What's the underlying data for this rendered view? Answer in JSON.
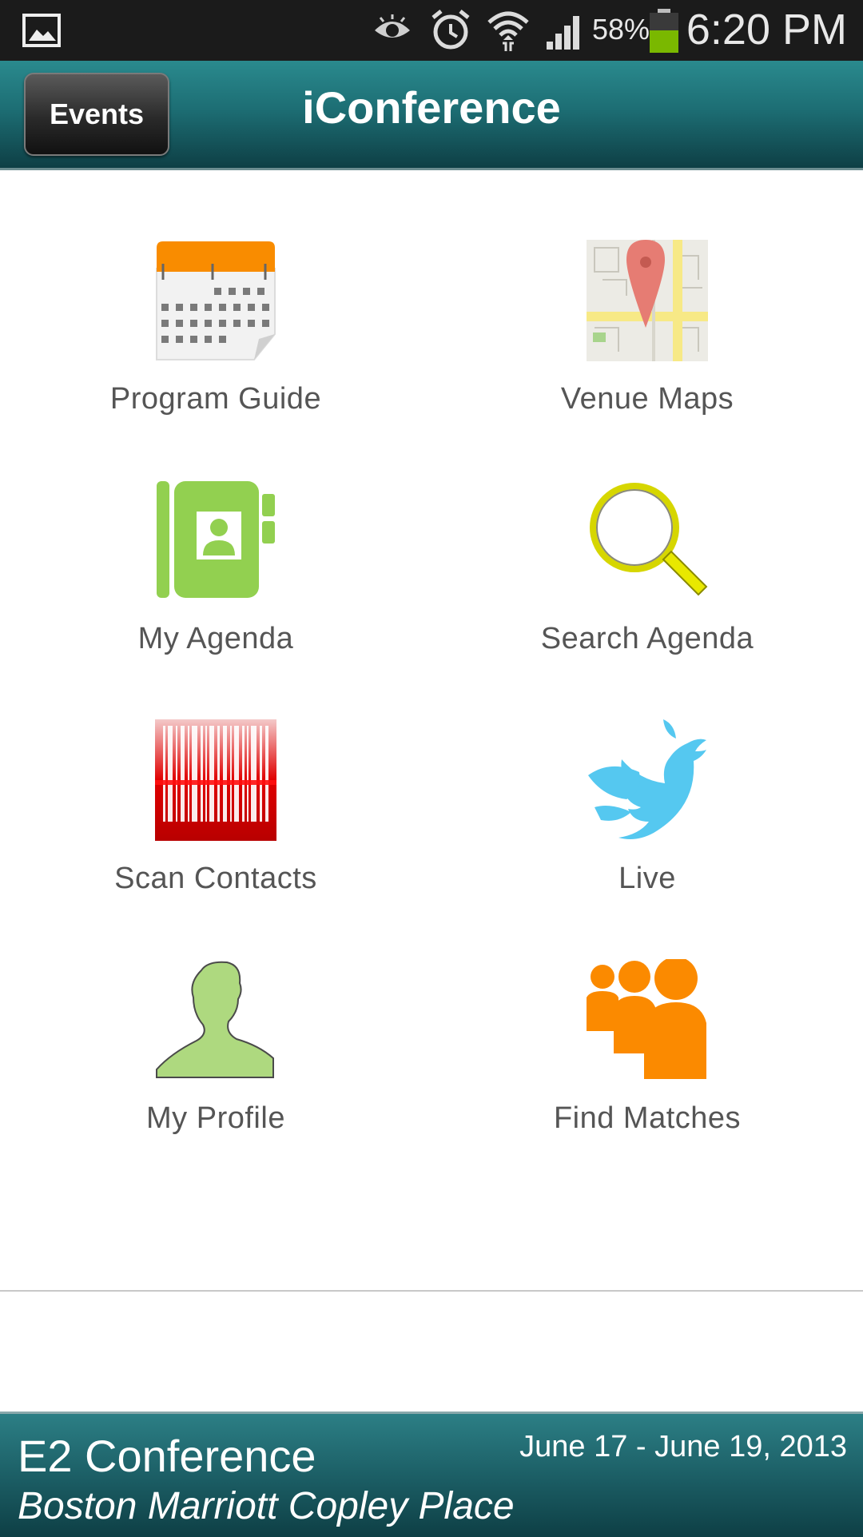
{
  "status_bar": {
    "battery_percent": "58%",
    "time": "6:20 PM",
    "icons": [
      "gallery-icon",
      "eye-icon",
      "alarm-icon",
      "wifi-icon",
      "signal-icon",
      "battery-icon"
    ]
  },
  "header": {
    "back_button": "Events",
    "title": "iConference"
  },
  "menu": {
    "items": [
      {
        "label": "Program Guide",
        "icon": "calendar-icon"
      },
      {
        "label": "Venue Maps",
        "icon": "map-icon"
      },
      {
        "label": "My Agenda",
        "icon": "address-book-icon"
      },
      {
        "label": "Search Agenda",
        "icon": "magnifier-icon"
      },
      {
        "label": "Scan Contacts",
        "icon": "barcode-icon"
      },
      {
        "label": "Live",
        "icon": "twitter-bird-icon"
      },
      {
        "label": "My Profile",
        "icon": "person-icon"
      },
      {
        "label": "Find Matches",
        "icon": "group-icon"
      }
    ]
  },
  "footer": {
    "conference_name": "E2 Conference",
    "dates": "June 17 - June 19, 2013",
    "venue": "Boston Marriott Copley Place"
  },
  "colors": {
    "header_teal": "#1d6e74",
    "calendar_orange": "#f98c00",
    "agenda_green": "#92d050",
    "twitter_blue": "#55c8f0",
    "matches_orange": "#fb8a00",
    "label_gray": "#555555"
  }
}
